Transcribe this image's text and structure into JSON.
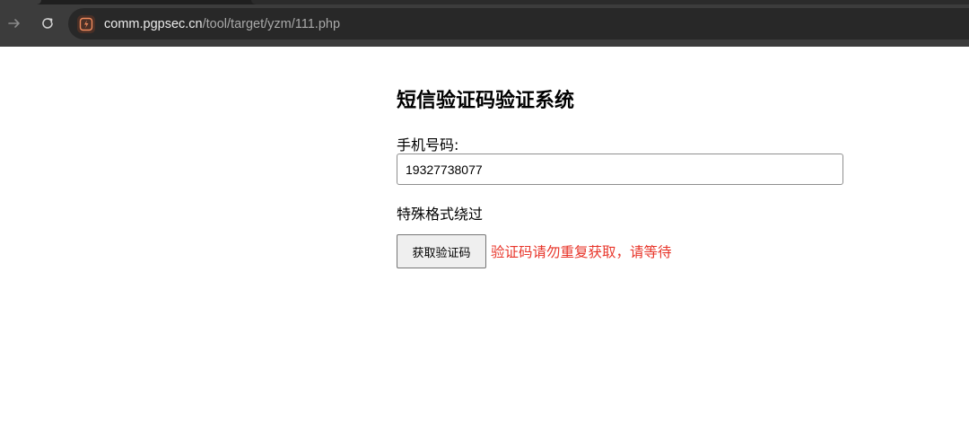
{
  "browser": {
    "url_host": "comm.pgpsec.cn",
    "url_path": "/tool/target/yzm/111.php",
    "site_icon": "lightning-bolt-icon",
    "back_icon": "arrow-right-icon",
    "reload_icon": "reload-icon"
  },
  "page": {
    "title": "短信验证码验证系统",
    "phone_label": "手机号码:",
    "phone_value": "19327738077",
    "bypass_text": "特殊格式绕过",
    "get_code_label": "获取验证码",
    "status_message": "验证码请勿重复获取，请等待"
  },
  "colors": {
    "status_text": "#e8352a",
    "chrome_bg": "#3c3c3c",
    "omnibox_bg": "#282828"
  }
}
